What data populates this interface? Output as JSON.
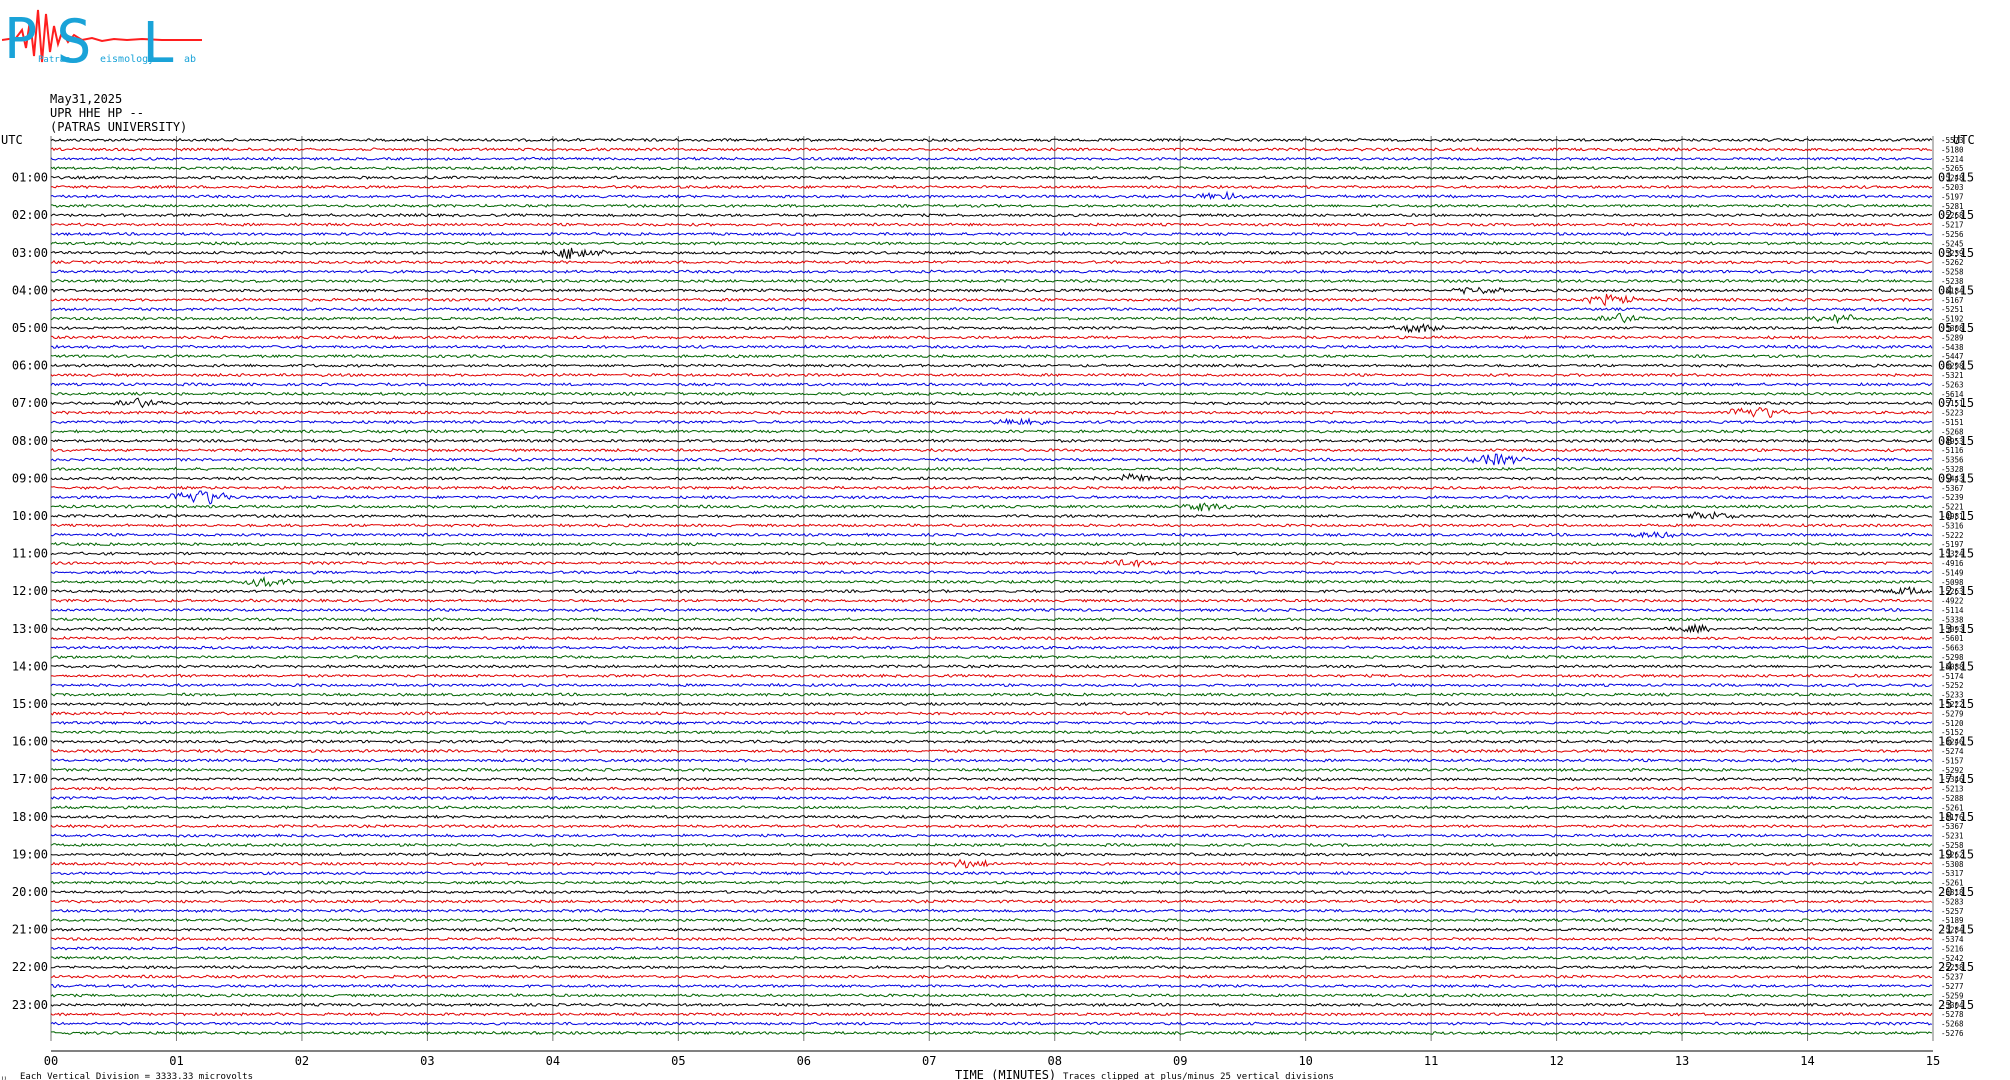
{
  "logo": {
    "letters": [
      "P",
      "S",
      "L"
    ],
    "small_words": [
      "Patras",
      "eismology",
      "ab"
    ],
    "colors": {
      "letters": "#1aa3d8",
      "trace": "#ff1e1e"
    }
  },
  "header": {
    "date": "May31,2025",
    "station": "UPR HHE HP --",
    "institution": "(PATRAS UNIVERSITY)"
  },
  "chart_data": {
    "type": "line",
    "kind": "helicorder seismogram",
    "xlabel": "TIME (MINUTES)",
    "x_ticks": [
      "00",
      "01",
      "02",
      "03",
      "04",
      "05",
      "06",
      "07",
      "08",
      "09",
      "10",
      "11",
      "12",
      "13",
      "14",
      "15"
    ],
    "xlim": [
      0,
      15
    ],
    "left_axis_title": "UTC",
    "right_axis_title": "UTC",
    "left_hour_labels": [
      "01:00",
      "02:00",
      "03:00",
      "04:00",
      "05:00",
      "06:00",
      "07:00",
      "08:00",
      "09:00",
      "10:00",
      "11:00",
      "12:00",
      "13:00",
      "14:00",
      "15:00",
      "16:00",
      "17:00",
      "18:00",
      "19:00",
      "20:00",
      "21:00",
      "22:00",
      "23:00"
    ],
    "right_hour_labels": [
      "01:15",
      "02:15",
      "03:15",
      "04:15",
      "05:15",
      "06:15",
      "07:15",
      "08:15",
      "09:15",
      "10:15",
      "11:15",
      "12:15",
      "13:15",
      "14:15",
      "15:15",
      "16:15",
      "17:15",
      "18:15",
      "19:15",
      "20:15",
      "21:15",
      "22:15",
      "23:15"
    ],
    "trace_minutes": 15,
    "traces_per_hour": 4,
    "trace_colors": [
      "#000000",
      "#e00000",
      "#0000e0",
      "#006400"
    ],
    "trace_offsets": [
      "-5573",
      "-5180",
      "-5214",
      "-5265",
      "-5248",
      "-5203",
      "-5197",
      "-5281",
      "-5268",
      "-5217",
      "-5256",
      "-5245",
      "-5239",
      "-5262",
      "-5258",
      "-5238",
      "-5184",
      "-5167",
      "-5251",
      "-5192",
      "-5308",
      "-5289",
      "-5438",
      "-5447",
      "-5298",
      "-5321",
      "-5263",
      "-5614",
      "-5151",
      "-5223",
      "-5151",
      "-5268",
      "-4953",
      "-5116",
      "-5356",
      "-5328",
      "-5443",
      "-5367",
      "-5239",
      "-5221",
      "-4981",
      "-5316",
      "-5222",
      "-5197",
      "-5324",
      "-4916",
      "-5149",
      "-5098",
      "-5263",
      "-4922",
      "-5114",
      "-5338",
      "-5093",
      "-5601",
      "-5663",
      "-5298",
      "-5088",
      "-5174",
      "-5252",
      "-5233",
      "-5222",
      "-5279",
      "-5120",
      "-5152",
      "-5246",
      "-5274",
      "-5157",
      "-5292",
      "-5346",
      "-5213",
      "-5288",
      "-5261",
      "-5176",
      "-5367",
      "-5231",
      "-5258",
      "-5262",
      "-5308",
      "-5317",
      "-5261",
      "-5318",
      "-5283",
      "-5257",
      "-5189",
      "-5284",
      "-5374",
      "-5216",
      "-5242",
      "-5238",
      "-5237",
      "-5277",
      "-5259",
      "-5304",
      "-5278",
      "-5268",
      "-5276"
    ],
    "events": [
      {
        "trace": 6,
        "minute": 9.3,
        "strength": 1.2
      },
      {
        "trace": 12,
        "minute": 4.2,
        "strength": 2.0
      },
      {
        "trace": 16,
        "minute": 11.4,
        "strength": 1.0
      },
      {
        "trace": 17,
        "minute": 12.4,
        "strength": 1.5
      },
      {
        "trace": 19,
        "minute": 12.5,
        "strength": 1.6
      },
      {
        "trace": 19,
        "minute": 14.3,
        "strength": 1.4
      },
      {
        "trace": 20,
        "minute": 10.9,
        "strength": 1.2
      },
      {
        "trace": 28,
        "minute": 0.7,
        "strength": 1.6
      },
      {
        "trace": 29,
        "minute": 13.6,
        "strength": 2.0
      },
      {
        "trace": 30,
        "minute": 7.7,
        "strength": 1.1
      },
      {
        "trace": 34,
        "minute": 11.5,
        "strength": 1.8
      },
      {
        "trace": 36,
        "minute": 8.6,
        "strength": 1.2
      },
      {
        "trace": 38,
        "minute": 1.2,
        "strength": 2.5
      },
      {
        "trace": 39,
        "minute": 9.2,
        "strength": 1.1
      },
      {
        "trace": 40,
        "minute": 13.2,
        "strength": 1.3
      },
      {
        "trace": 42,
        "minute": 12.8,
        "strength": 1.0
      },
      {
        "trace": 45,
        "minute": 8.6,
        "strength": 1.2
      },
      {
        "trace": 47,
        "minute": 1.7,
        "strength": 1.3
      },
      {
        "trace": 48,
        "minute": 14.8,
        "strength": 1.2
      },
      {
        "trace": 52,
        "minute": 13.1,
        "strength": 1.1
      },
      {
        "trace": 77,
        "minute": 7.3,
        "strength": 1.3
      }
    ]
  },
  "footer": {
    "left_note": "Each Vertical Division = 3333.33 microvolts",
    "right_note": "Traces clipped at plus/minus 25 vertical divisions",
    "corner_mark": "⌇⌇"
  }
}
